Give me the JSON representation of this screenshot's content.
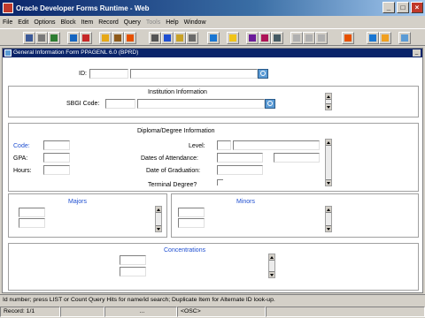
{
  "window": {
    "title": "Oracle Developer Forms Runtime - Web",
    "buttons": [
      "_",
      "□",
      "×"
    ]
  },
  "menu": [
    "File",
    "Edit",
    "Options",
    "Block",
    "Item",
    "Record",
    "Query",
    "Tools",
    "Help",
    "Window"
  ],
  "menu_disabled": [
    "Tools"
  ],
  "toolbar_icons": [
    "save-icon",
    "print-icon",
    "exit-icon",
    "rollback-icon",
    "clear-icon",
    "insert-record-icon",
    "delete-record-icon",
    "lock-icon",
    "cut-icon",
    "copy-icon",
    "paste-icon",
    "previous-block-icon",
    "next-block-icon",
    "enter-query-icon",
    "execute-query-icon",
    "cancel-query-icon",
    "list-icon",
    "help-icon",
    "keys-icon",
    "close-form-icon"
  ],
  "form": {
    "title": "General Information Form  PPAGENL  6.0  (BPRD)",
    "id_label": "ID:",
    "institution": {
      "heading": "Institution Information",
      "sbgi_label": "SBGI Code:"
    },
    "diploma": {
      "heading": "Diploma/Degree Information",
      "code_label": "Code:",
      "gpa_label": "GPA:",
      "hours_label": "Hours:",
      "level_label": "Level:",
      "dates_label": "Dates of Attendance:",
      "graduation_label": "Date of Graduation:",
      "terminal_label": "Terminal Degree?"
    },
    "majors_heading": "Majors",
    "minors_heading": "Minors",
    "concentrations_heading": "Concentrations"
  },
  "hint": "Id number; press LIST or Count Query Hits for name/id search; Duplicate Item for Alternate ID look-up.",
  "status": {
    "record": "Record: 1/1",
    "mode": "...",
    "osc": "<OSC>"
  },
  "colors": {
    "titlebar": "#0a246a",
    "label_blue": "#1f4fd1",
    "chrome": "#d4d0c8"
  }
}
